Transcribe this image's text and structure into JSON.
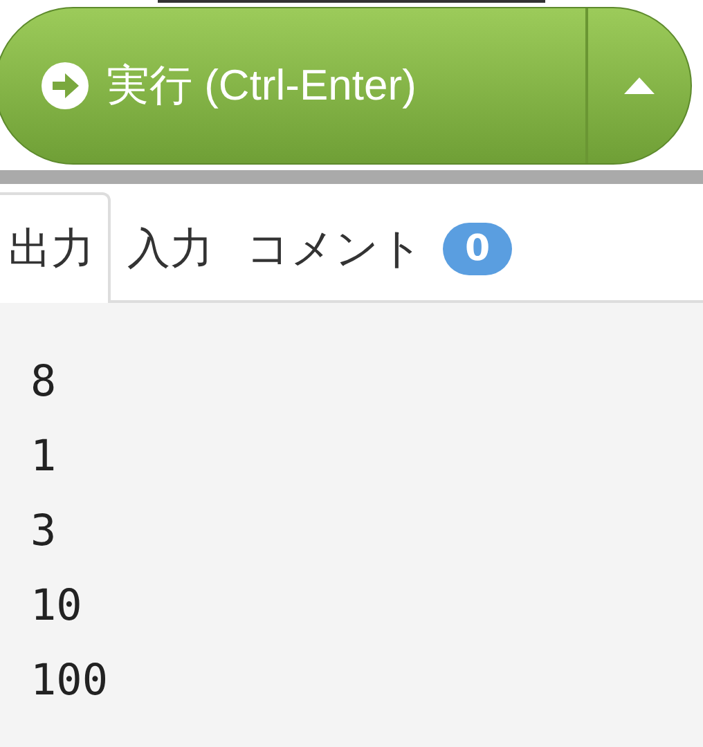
{
  "run_button": {
    "label": "実行 (Ctrl-Enter)"
  },
  "tabs": [
    {
      "label": "出力",
      "selected": true
    },
    {
      "label": "入力",
      "selected": false
    },
    {
      "label": "コメント",
      "selected": false,
      "badge": "0"
    }
  ],
  "output_lines": [
    "8",
    "1",
    "3",
    "10",
    "100"
  ]
}
